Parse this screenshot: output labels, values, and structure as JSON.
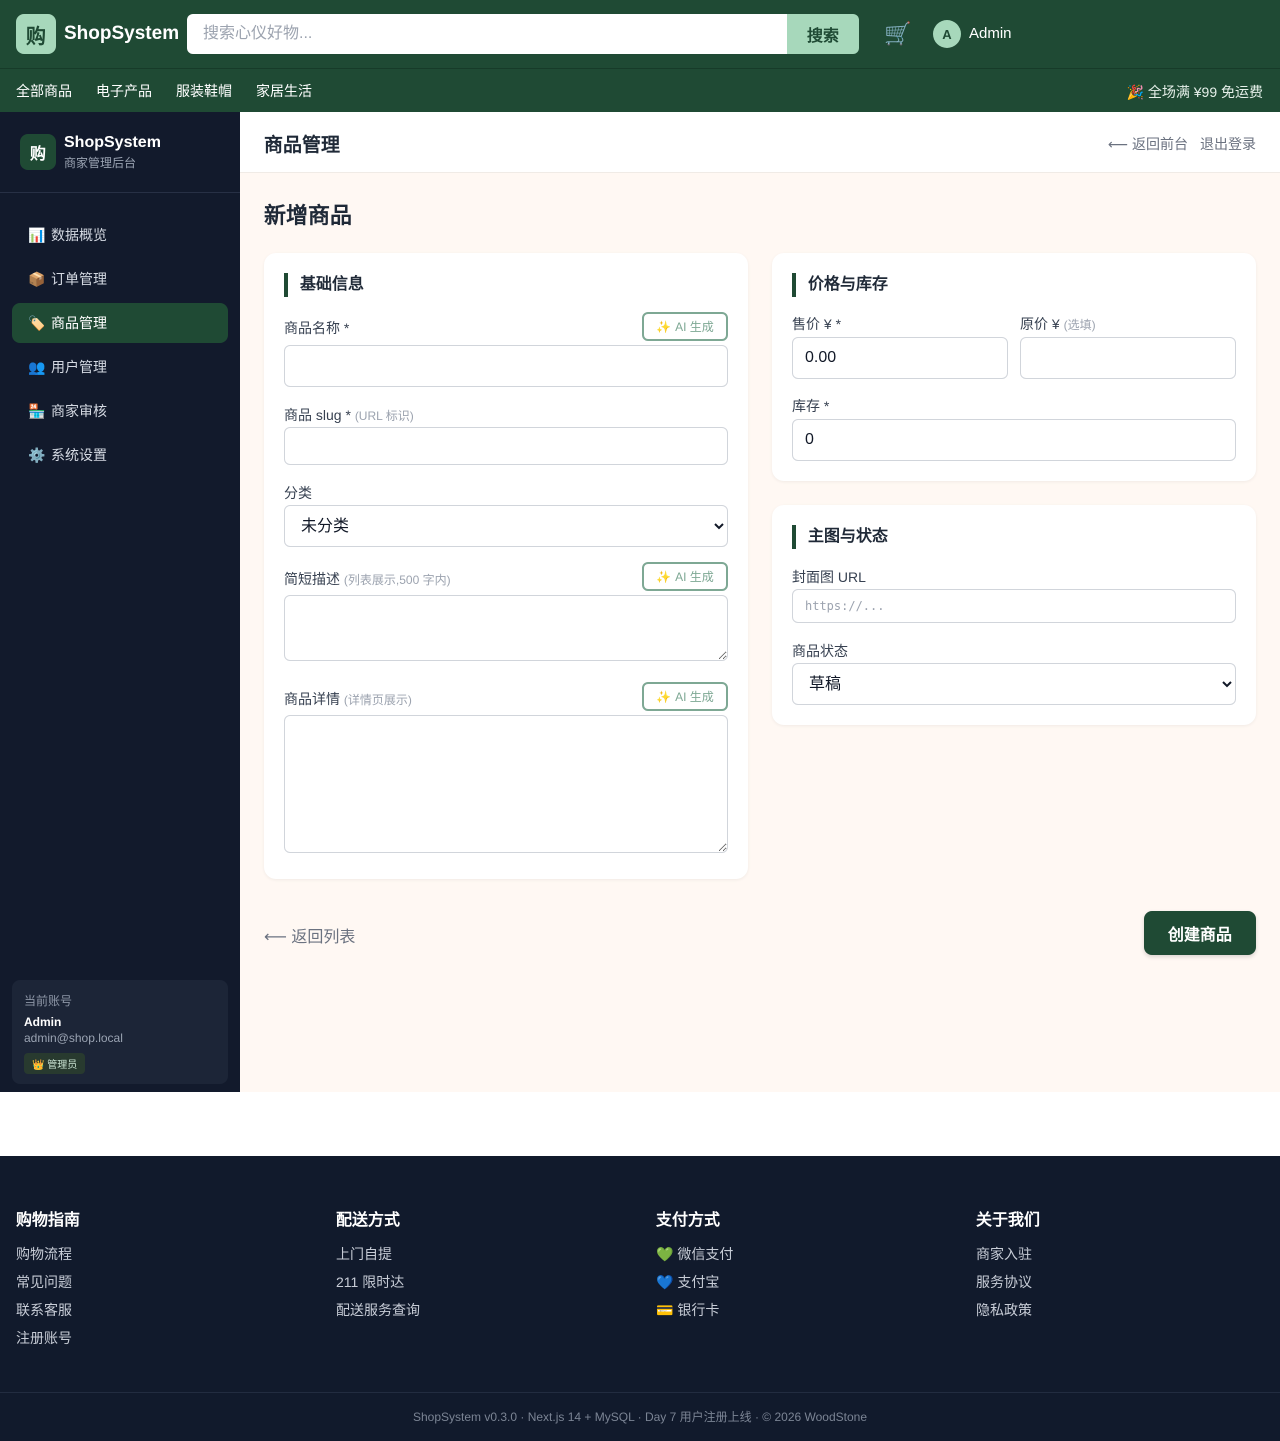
{
  "header": {
    "logo_char": "购",
    "brand": "ShopSystem",
    "search_placeholder": "搜索心仪好物...",
    "search_button": "搜索",
    "cart_icon": "🛒",
    "avatar_initial": "A",
    "user_name": "Admin"
  },
  "categories": {
    "items": [
      "全部商品",
      "电子产品",
      "服装鞋帽",
      "家居生活"
    ],
    "promo": "🎉 全场满 ¥99 免运费"
  },
  "sidebar": {
    "logo_char": "购",
    "title": "ShopSystem",
    "subtitle": "商家管理后台",
    "items": [
      {
        "icon": "📊",
        "label": "数据概览"
      },
      {
        "icon": "📦",
        "label": "订单管理"
      },
      {
        "icon": "🏷️",
        "label": "商品管理"
      },
      {
        "icon": "👥",
        "label": "用户管理"
      },
      {
        "icon": "🏪",
        "label": "商家审核"
      },
      {
        "icon": "⚙️",
        "label": "系统设置"
      }
    ],
    "account": {
      "label": "当前账号",
      "name": "Admin",
      "email": "admin@shop.local",
      "badge": "👑 管理员"
    }
  },
  "main": {
    "page_title": "商品管理",
    "back_to_front": "⟵ 返回前台",
    "logout": "退出登录",
    "section_title": "新增商品",
    "basic": {
      "title": "基础信息",
      "name_label": "商品名称 *",
      "slug_label": "商品 slug *",
      "slug_hint": "(URL 标识)",
      "category_label": "分类",
      "category_value": "未分类",
      "short_desc_label": "简短描述",
      "short_desc_hint": "(列表展示,500 字内)",
      "detail_label": "商品详情",
      "detail_hint": "(详情页展示)",
      "ai_button": "AI 生成",
      "ai_spark": "✨"
    },
    "price": {
      "title": "价格与库存",
      "sale_label": "售价 ¥ *",
      "sale_value": "0.00",
      "orig_label": "原价 ¥",
      "orig_hint": "(选填)",
      "stock_label": "库存 *",
      "stock_value": "0"
    },
    "media": {
      "title": "主图与状态",
      "cover_label": "封面图 URL",
      "cover_placeholder": "https://...",
      "status_label": "商品状态",
      "status_value": "草稿"
    },
    "back_list": "⟵ 返回列表",
    "create_button": "创建商品"
  },
  "footer": {
    "columns": [
      {
        "head": "购物指南",
        "links": [
          "购物流程",
          "常见问题",
          "联系客服",
          "注册账号"
        ]
      },
      {
        "head": "配送方式",
        "links": [
          "上门自提",
          "211 限时达",
          "配送服务查询"
        ]
      },
      {
        "head": "支付方式",
        "links": [
          "💚 微信支付",
          "💙 支付宝",
          "💳 银行卡"
        ]
      },
      {
        "head": "关于我们",
        "links": [
          "商家入驻",
          "服务协议",
          "隐私政策"
        ]
      }
    ],
    "copyright": "ShopSystem v0.3.0 · Next.js 14 + MySQL · Day 7 用户注册上线 · © 2026 WoodStone"
  },
  "colors": {
    "brand_green": "#1f4a34",
    "accent_mint": "#a7d8bb",
    "sidebar_bg": "#121a2c",
    "main_bg": "#fff8f3"
  }
}
